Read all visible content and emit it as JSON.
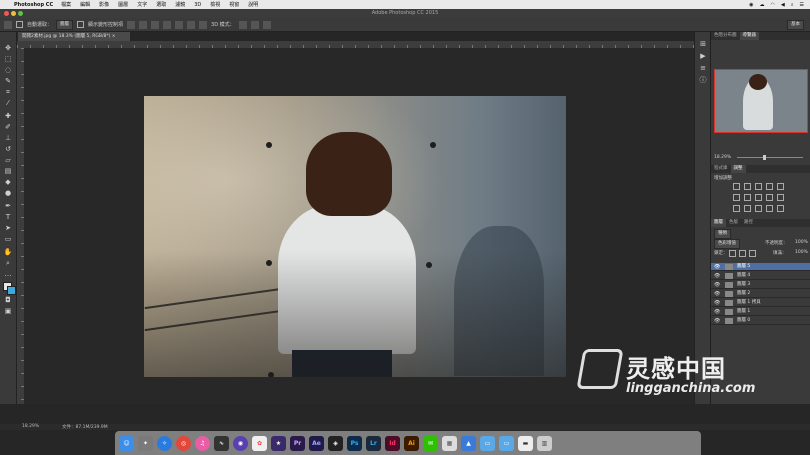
{
  "menubar": {
    "apple": "",
    "app_name": "Photoshop CC",
    "items": [
      "檔案",
      "編輯",
      "影像",
      "圖層",
      "文字",
      "選取",
      "濾鏡",
      "3D",
      "檢視",
      "視窗",
      "說明"
    ]
  },
  "window": {
    "title": "Adobe Photoshop CC 2015"
  },
  "options": {
    "auto_select_label": "自動選取：",
    "auto_select_value": "圖層",
    "show_transform_label": "顯示變形控制項",
    "mode_3d": "3D 模式：",
    "workspace": "基本"
  },
  "document": {
    "tab_title": "開闊2素材.jpg @ 18.3% (圖層 5, RGB/8*) ×"
  },
  "panels": {
    "top_tabs": [
      "色階分布圖",
      "導覽器"
    ],
    "zoom": "18.29%",
    "mid_tabs": [
      "程式庫",
      "調整"
    ],
    "adjust_title": "增加調整",
    "layer_tabs": [
      "圖層",
      "色版",
      "路徑"
    ],
    "filter_label": "種類",
    "blend_mode": "色彩增值",
    "opacity_label": "不透明度：",
    "opacity_value": "100%",
    "lock_label": "鎖定：",
    "fill_label": "填滿：",
    "fill_value": "100%",
    "layers": [
      {
        "name": "圖層 5",
        "selected": true
      },
      {
        "name": "圖層 4",
        "selected": false
      },
      {
        "name": "圖層 3",
        "selected": false
      },
      {
        "name": "圖層 2",
        "selected": false
      },
      {
        "name": "圖層 1 拷貝",
        "selected": false
      },
      {
        "name": "圖層 1",
        "selected": false
      },
      {
        "name": "圖層 0",
        "selected": false
      }
    ]
  },
  "status": {
    "zoom": "18.29%",
    "doc_size": "文件：87.1M/239.9M"
  },
  "dock_apps": [
    "Finder",
    "Launchpad",
    "Safari",
    "Chrome",
    "iTunes",
    "Activity",
    "Siri",
    "Photos",
    "Premiere",
    "After Effects",
    "DaVinci",
    "Photoshop",
    "Lightroom",
    "InDesign",
    "Illustrator",
    "WeChat",
    "Preview",
    "Keynote",
    "Folder",
    "Folder",
    "Screen",
    "Files",
    "Trash"
  ],
  "dock_labels": [
    "Pr",
    "Ae",
    "Ps",
    "Lr",
    "Id",
    "Ai"
  ],
  "watermark": {
    "cn": "灵感中国",
    "en": "lingganchina.com"
  }
}
